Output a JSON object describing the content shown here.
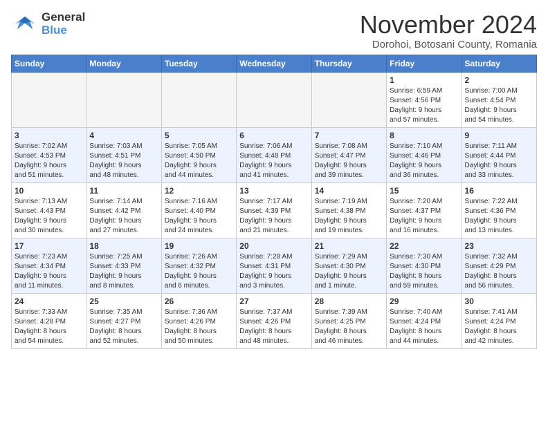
{
  "logo": {
    "line1": "General",
    "line2": "Blue"
  },
  "title": "November 2024",
  "subtitle": "Dorohoi, Botosani County, Romania",
  "weekdays": [
    "Sunday",
    "Monday",
    "Tuesday",
    "Wednesday",
    "Thursday",
    "Friday",
    "Saturday"
  ],
  "weeks": [
    [
      {
        "day": "",
        "info": ""
      },
      {
        "day": "",
        "info": ""
      },
      {
        "day": "",
        "info": ""
      },
      {
        "day": "",
        "info": ""
      },
      {
        "day": "",
        "info": ""
      },
      {
        "day": "1",
        "info": "Sunrise: 6:59 AM\nSunset: 4:56 PM\nDaylight: 9 hours\nand 57 minutes."
      },
      {
        "day": "2",
        "info": "Sunrise: 7:00 AM\nSunset: 4:54 PM\nDaylight: 9 hours\nand 54 minutes."
      }
    ],
    [
      {
        "day": "3",
        "info": "Sunrise: 7:02 AM\nSunset: 4:53 PM\nDaylight: 9 hours\nand 51 minutes."
      },
      {
        "day": "4",
        "info": "Sunrise: 7:03 AM\nSunset: 4:51 PM\nDaylight: 9 hours\nand 48 minutes."
      },
      {
        "day": "5",
        "info": "Sunrise: 7:05 AM\nSunset: 4:50 PM\nDaylight: 9 hours\nand 44 minutes."
      },
      {
        "day": "6",
        "info": "Sunrise: 7:06 AM\nSunset: 4:48 PM\nDaylight: 9 hours\nand 41 minutes."
      },
      {
        "day": "7",
        "info": "Sunrise: 7:08 AM\nSunset: 4:47 PM\nDaylight: 9 hours\nand 39 minutes."
      },
      {
        "day": "8",
        "info": "Sunrise: 7:10 AM\nSunset: 4:46 PM\nDaylight: 9 hours\nand 36 minutes."
      },
      {
        "day": "9",
        "info": "Sunrise: 7:11 AM\nSunset: 4:44 PM\nDaylight: 9 hours\nand 33 minutes."
      }
    ],
    [
      {
        "day": "10",
        "info": "Sunrise: 7:13 AM\nSunset: 4:43 PM\nDaylight: 9 hours\nand 30 minutes."
      },
      {
        "day": "11",
        "info": "Sunrise: 7:14 AM\nSunset: 4:42 PM\nDaylight: 9 hours\nand 27 minutes."
      },
      {
        "day": "12",
        "info": "Sunrise: 7:16 AM\nSunset: 4:40 PM\nDaylight: 9 hours\nand 24 minutes."
      },
      {
        "day": "13",
        "info": "Sunrise: 7:17 AM\nSunset: 4:39 PM\nDaylight: 9 hours\nand 21 minutes."
      },
      {
        "day": "14",
        "info": "Sunrise: 7:19 AM\nSunset: 4:38 PM\nDaylight: 9 hours\nand 19 minutes."
      },
      {
        "day": "15",
        "info": "Sunrise: 7:20 AM\nSunset: 4:37 PM\nDaylight: 9 hours\nand 16 minutes."
      },
      {
        "day": "16",
        "info": "Sunrise: 7:22 AM\nSunset: 4:36 PM\nDaylight: 9 hours\nand 13 minutes."
      }
    ],
    [
      {
        "day": "17",
        "info": "Sunrise: 7:23 AM\nSunset: 4:34 PM\nDaylight: 9 hours\nand 11 minutes."
      },
      {
        "day": "18",
        "info": "Sunrise: 7:25 AM\nSunset: 4:33 PM\nDaylight: 9 hours\nand 8 minutes."
      },
      {
        "day": "19",
        "info": "Sunrise: 7:26 AM\nSunset: 4:32 PM\nDaylight: 9 hours\nand 6 minutes."
      },
      {
        "day": "20",
        "info": "Sunrise: 7:28 AM\nSunset: 4:31 PM\nDaylight: 9 hours\nand 3 minutes."
      },
      {
        "day": "21",
        "info": "Sunrise: 7:29 AM\nSunset: 4:30 PM\nDaylight: 9 hours\nand 1 minute."
      },
      {
        "day": "22",
        "info": "Sunrise: 7:30 AM\nSunset: 4:30 PM\nDaylight: 8 hours\nand 59 minutes."
      },
      {
        "day": "23",
        "info": "Sunrise: 7:32 AM\nSunset: 4:29 PM\nDaylight: 8 hours\nand 56 minutes."
      }
    ],
    [
      {
        "day": "24",
        "info": "Sunrise: 7:33 AM\nSunset: 4:28 PM\nDaylight: 8 hours\nand 54 minutes."
      },
      {
        "day": "25",
        "info": "Sunrise: 7:35 AM\nSunset: 4:27 PM\nDaylight: 8 hours\nand 52 minutes."
      },
      {
        "day": "26",
        "info": "Sunrise: 7:36 AM\nSunset: 4:26 PM\nDaylight: 8 hours\nand 50 minutes."
      },
      {
        "day": "27",
        "info": "Sunrise: 7:37 AM\nSunset: 4:26 PM\nDaylight: 8 hours\nand 48 minutes."
      },
      {
        "day": "28",
        "info": "Sunrise: 7:39 AM\nSunset: 4:25 PM\nDaylight: 8 hours\nand 46 minutes."
      },
      {
        "day": "29",
        "info": "Sunrise: 7:40 AM\nSunset: 4:24 PM\nDaylight: 8 hours\nand 44 minutes."
      },
      {
        "day": "30",
        "info": "Sunrise: 7:41 AM\nSunset: 4:24 PM\nDaylight: 8 hours\nand 42 minutes."
      }
    ]
  ]
}
